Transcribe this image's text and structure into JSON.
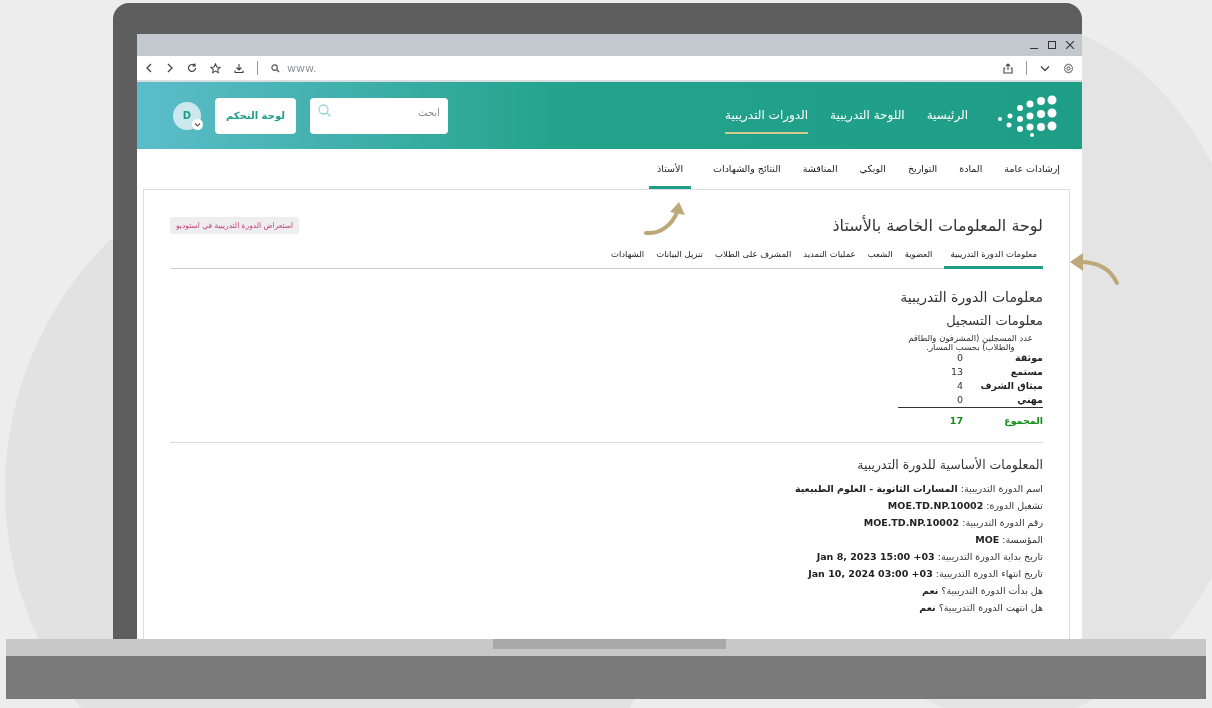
{
  "browser": {
    "address_placeholder": "www."
  },
  "header": {
    "nav": [
      {
        "label": "الرئيسية",
        "selected": false
      },
      {
        "label": "اللوحة التدريبية",
        "selected": false
      },
      {
        "label": "الدورات التدريبية",
        "selected": true
      }
    ],
    "search": {
      "placeholder": "ابحث"
    },
    "dashboard_button": "لوحة التحكم",
    "avatar": "D"
  },
  "course_tabs": [
    {
      "label": "إرشادات عامة",
      "selected": false
    },
    {
      "label": "المادة",
      "selected": false
    },
    {
      "label": "التواريخ",
      "selected": false
    },
    {
      "label": "الويكي",
      "selected": false
    },
    {
      "label": "المناقشة",
      "selected": false
    },
    {
      "label": "النتائج والشهادات",
      "selected": false
    },
    {
      "label": "الأستاذ",
      "selected": true
    }
  ],
  "panel": {
    "title": "لوحة المعلومات الخاصة بالأستاذ",
    "studio_button": "استعراض الدورة التدريبية في استوديو",
    "tabs": [
      {
        "label": "معلومات الدورة التدريبية",
        "selected": true
      },
      {
        "label": "العضوية",
        "selected": false
      },
      {
        "label": "الشعب",
        "selected": false
      },
      {
        "label": "عمليات التمديد",
        "selected": false
      },
      {
        "label": "المشرف على الطلاب",
        "selected": false
      },
      {
        "label": "تنزيل البيانات",
        "selected": false
      },
      {
        "label": "الشهادات",
        "selected": false
      }
    ],
    "section_title": "معلومات الدورة التدريبية",
    "registration": {
      "title": "معلومات التسجيل",
      "description": "عدد المسجلين (المشرفون والطاقم والطلاب) بحسب المسار.",
      "rows": [
        {
          "label": "موثقة",
          "value": "0"
        },
        {
          "label": "مستمع",
          "value": "13"
        },
        {
          "label": "ميثاق الشرف",
          "value": "4"
        },
        {
          "label": "مهني",
          "value": "0"
        }
      ],
      "total": {
        "label": "المجموع",
        "value": "17"
      }
    },
    "basic_info": {
      "title": "المعلومات الأساسية للدورة التدريبية",
      "rows": [
        {
          "label": "اسم الدورة التدريبية:",
          "value": "المسارات الثانوية - العلوم الطبيعية"
        },
        {
          "label": "تشغيل الدورة:",
          "value": "MOE.TD.NP.10002"
        },
        {
          "label": "رقم الدورة التدريبية:",
          "value": "MOE.TD.NP.10002"
        },
        {
          "label": "المؤسسة:",
          "value": "MOE"
        },
        {
          "label": "تاريخ بداية الدورة التدريبية:",
          "value": "Jan 8, 2023 15:00 +03"
        },
        {
          "label": "تاريخ انتهاء الدورة التدريبية:",
          "value": "Jan 10, 2024 03:00 +03"
        },
        {
          "label": "هل بدأت الدورة التدريبية؟",
          "value": "نعم"
        },
        {
          "label": "هل انتهت الدورة التدريبية؟",
          "value": "نعم"
        }
      ]
    }
  }
}
